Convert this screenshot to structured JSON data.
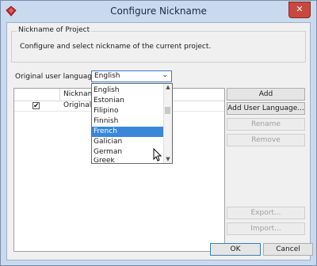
{
  "window": {
    "title": "Configure Nickname",
    "close_glyph": "✕"
  },
  "group": {
    "title": "Nickname of Project",
    "description": "Configure and select nickname of the current project."
  },
  "language": {
    "label": "Original user language:",
    "selected": "English",
    "options": [
      "English",
      "Estonian",
      "Filipino",
      "Finnish",
      "French",
      "Galician",
      "German",
      "Greek"
    ],
    "highlighted": "French"
  },
  "table": {
    "headers": [
      "",
      "Nickname"
    ],
    "rows": [
      {
        "checked": true,
        "check_glyph": "✔",
        "label": "Original"
      }
    ]
  },
  "buttons": {
    "add": "Add",
    "add_user_language": "Add User Language...",
    "rename": "Rename",
    "remove": "Remove",
    "export": "Export...",
    "import": "Import...",
    "ok": "OK",
    "cancel": "Cancel"
  },
  "icons": {
    "app": "diamond-app-icon",
    "close": "close-icon",
    "dropdown_arrow": "chevron-down-icon",
    "cursor": "mouse-pointer-icon"
  }
}
